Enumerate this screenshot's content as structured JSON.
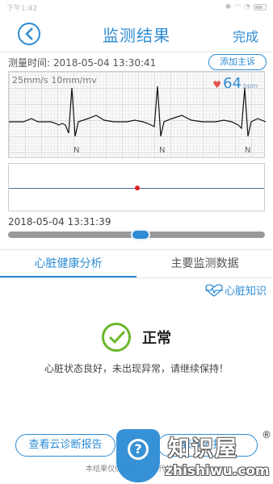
{
  "status_bar": {
    "time": "下午1:42"
  },
  "header": {
    "title": "监测结果",
    "done_label": "完成",
    "back_icon": "chevron-left-icon"
  },
  "measure": {
    "time_text": "测量时间: 2018-05-04 13:30:41",
    "complaint_button": "添加主诉"
  },
  "ecg": {
    "scale_text": "25mm/s  10mm/mv",
    "heart_rate": "64",
    "heart_rate_unit": "bpm",
    "beat_labels": [
      "N",
      "N",
      "N"
    ]
  },
  "timeline": {
    "current_time": "2018-05-04 13:31:39",
    "position": 0.5
  },
  "tabs": [
    {
      "label": "心脏健康分析"
    },
    {
      "label": "主要监测数据"
    }
  ],
  "knowledge_link": "心脏知识",
  "result": {
    "status": "正常",
    "description": "心脏状态良好，未出现异常，请继续保持！"
  },
  "buttons": {
    "cloud_report": "查看云诊断报告",
    "second": "获取云报告"
  },
  "disclaimer": "本结果仅供参考，不能代替诊断",
  "watermark": {
    "brand": "知识屋",
    "domain": "zhishiwu.com"
  },
  "colors": {
    "accent": "#2d8cd4",
    "ok": "#6ab82a",
    "heart": "#e2554a",
    "marker": "#e02020"
  }
}
